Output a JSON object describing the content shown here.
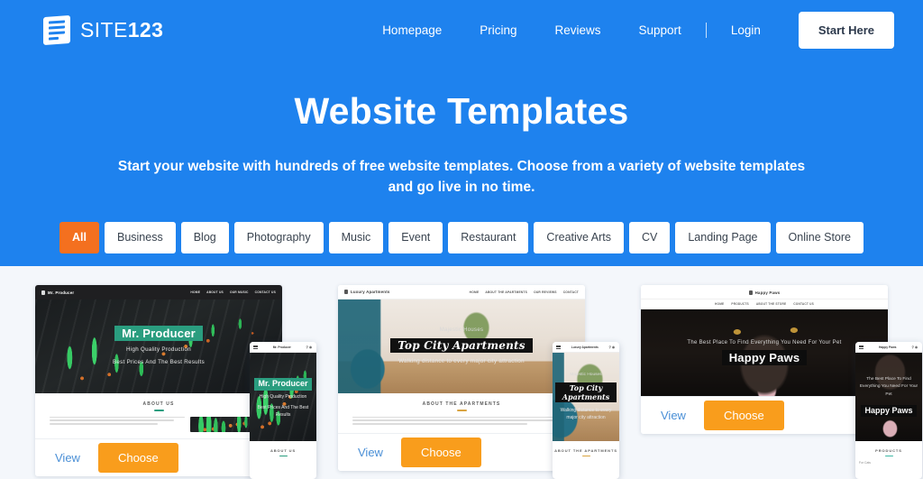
{
  "header": {
    "brand": {
      "text_light": "SITE",
      "text_bold": "123",
      "icon": "document-lines-icon"
    },
    "nav": [
      {
        "label": "Homepage"
      },
      {
        "label": "Pricing"
      },
      {
        "label": "Reviews"
      },
      {
        "label": "Support"
      },
      {
        "label": "Login"
      }
    ],
    "cta_label": "Start Here",
    "accent_color": "#1e82ee"
  },
  "hero": {
    "title": "Website Templates",
    "subtitle": "Start your website with hundreds of free website templates. Choose from a variety of website templates and go live in no time.",
    "filters": [
      {
        "label": "All",
        "active": true
      },
      {
        "label": "Business",
        "active": false
      },
      {
        "label": "Blog",
        "active": false
      },
      {
        "label": "Photography",
        "active": false
      },
      {
        "label": "Music",
        "active": false
      },
      {
        "label": "Event",
        "active": false
      },
      {
        "label": "Restaurant",
        "active": false
      },
      {
        "label": "Creative Arts",
        "active": false
      },
      {
        "label": "CV",
        "active": false
      },
      {
        "label": "Landing Page",
        "active": false
      },
      {
        "label": "Online Store",
        "active": false
      }
    ],
    "active_filter_color": "#f4701f"
  },
  "templates": [
    {
      "site_name": "Mr. Producer",
      "hero_title": "Mr. Producer",
      "hero_line_1": "High Quality Production",
      "hero_line_2": "Best Prices And The Best Results",
      "about_title": "ABOUT US",
      "accent_color": "#2a9d7f",
      "nav": [
        "HOME",
        "ABOUT US",
        "OUR MUSIC",
        "CONTACT US"
      ],
      "view_label": "View",
      "choose_label": "Choose",
      "phone_about_title": "ABOUT US"
    },
    {
      "site_name": "Luxury Apartments",
      "hero_title": "Top City Apartments",
      "hero_line_1": "Majestic Houses",
      "hero_line_2": "Walking distance to every major city attraction",
      "about_title": "ABOUT THE APARTMENTS",
      "accent_color": "#d9a441",
      "nav": [
        "HOME",
        "ABOUT THE APARTMENTS",
        "OUR REVIEWS",
        "CONTACT"
      ],
      "view_label": "View",
      "choose_label": "Choose",
      "phone_about_title": "ABOUT THE APARTMENTS"
    },
    {
      "site_name": "Happy Paws",
      "hero_title": "Happy Paws",
      "hero_line_1": "The Best Place To Find Everything You Need For Your Pet",
      "hero_line_2": "",
      "about_title": "PRODUCTS",
      "accent_color": "#3fb8a4",
      "nav": [
        "HOME",
        "PRODUCTS",
        "ABOUT THE STORE",
        "CONTACT US"
      ],
      "view_label": "View",
      "choose_label": "Choose",
      "phone_about_title": "PRODUCTS",
      "phone_caption": "For Cats"
    }
  ]
}
